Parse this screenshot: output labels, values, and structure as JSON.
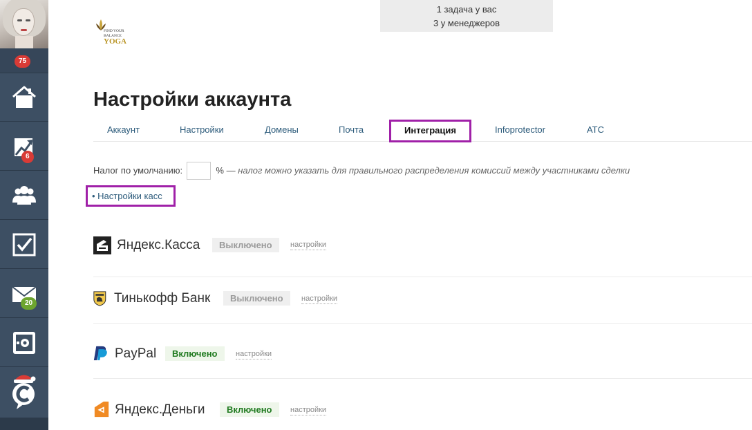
{
  "sidebar": {
    "notifications_count": "75",
    "items": [
      {
        "name": "home",
        "icon": "home-icon",
        "badge": ""
      },
      {
        "name": "stats",
        "icon": "chart-icon",
        "badge": "6",
        "badge_color": "#d93b36"
      },
      {
        "name": "users",
        "icon": "users-icon",
        "badge": ""
      },
      {
        "name": "tasks",
        "icon": "checkbox-icon",
        "badge": ""
      },
      {
        "name": "mail",
        "icon": "mail-icon",
        "badge": "20",
        "badge_color": "#6da52f"
      },
      {
        "name": "safe",
        "icon": "safe-icon",
        "badge": ""
      },
      {
        "name": "support",
        "icon": "support-c-icon",
        "badge": ""
      }
    ]
  },
  "tasks": {
    "line1": "1 задача у вас",
    "line2": "3 у менеджеров"
  },
  "logo": {
    "line1": "FIND YOUR",
    "line2": "BALANCE",
    "line3": "YOGA"
  },
  "page": {
    "title": "Настройки аккаунта"
  },
  "tabs": [
    {
      "label": "Аккаунт",
      "active": false
    },
    {
      "label": "Настройки",
      "active": false
    },
    {
      "label": "Домены",
      "active": false
    },
    {
      "label": "Почта",
      "active": false
    },
    {
      "label": "Интеграция",
      "active": true
    },
    {
      "label": "Infoprotector",
      "active": false
    },
    {
      "label": "АТС",
      "active": false
    }
  ],
  "tax": {
    "label": "Налог по умолчанию:",
    "value": "",
    "unit": "% —",
    "hint": "налог можно указать для правильного распределения комиссий между участниками сделки"
  },
  "kassa_link": "• Настройки касс",
  "integrations": [
    {
      "name": "Яндекс.Касса",
      "status": "Выключено",
      "enabled": false,
      "settings": "настройки",
      "icon": "yandex-kassa-icon"
    },
    {
      "name": "Тинькофф Банк",
      "status": "Выключено",
      "enabled": false,
      "settings": "настройки",
      "icon": "tinkoff-icon"
    },
    {
      "name": "PayPal",
      "status": "Включено",
      "enabled": true,
      "settings": "настройки",
      "icon": "paypal-icon"
    },
    {
      "name": "Яндекс.Деньги",
      "status": "Включено",
      "enabled": true,
      "settings": "настройки",
      "icon": "yandex-money-icon"
    }
  ],
  "colors": {
    "sidebar": "#3d4f63",
    "highlight": "#a020a8",
    "link": "#2b5a7a",
    "enabled": "#1f7a1f"
  }
}
